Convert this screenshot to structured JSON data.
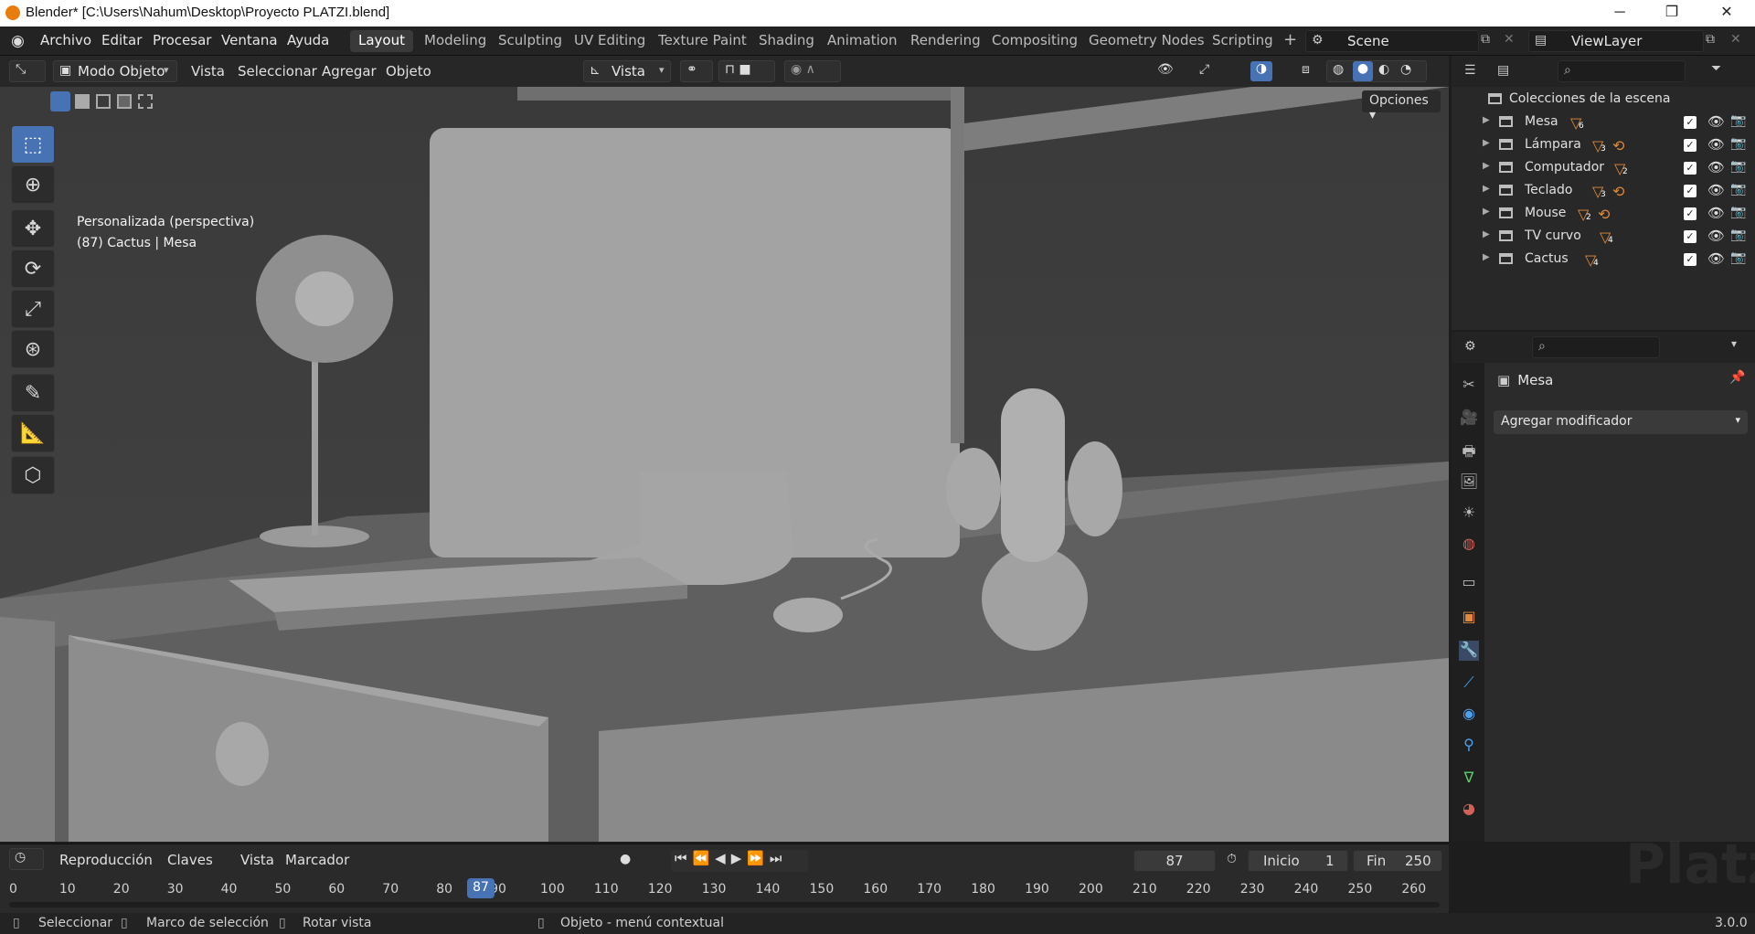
{
  "window": {
    "title": "Blender* [C:\\Users\\Nahum\\Desktop\\Proyecto PLATZI.blend]",
    "minimize": "─",
    "maximize": "❐",
    "close": "✕"
  },
  "menu": [
    "Archivo",
    "Editar",
    "Procesar",
    "Ventana",
    "Ayuda"
  ],
  "workspaces": [
    "Layout",
    "Modeling",
    "Sculpting",
    "UV Editing",
    "Texture Paint",
    "Shading",
    "Animation",
    "Rendering",
    "Compositing",
    "Geometry Nodes",
    "Scripting"
  ],
  "add_workspace": "+",
  "scene": "Scene",
  "viewlayer": "ViewLayer",
  "viewport_header": {
    "mode": "Modo Objeto",
    "menus": [
      "Vista",
      "Seleccionar",
      "Agregar",
      "Objeto"
    ],
    "orientation": "Vista",
    "options": "Opciones"
  },
  "viewport_info": {
    "line1": "Personalizada (perspectiva)",
    "line2": "(87) Cactus | Mesa"
  },
  "outliner": {
    "root": "Colecciones de la escena",
    "items": [
      {
        "name": "Mesa",
        "count": "6",
        "anim": false
      },
      {
        "name": "Lámpara",
        "count": "3",
        "anim": true
      },
      {
        "name": "Computador",
        "count": "2",
        "anim": false
      },
      {
        "name": "Teclado",
        "count": "3",
        "anim": true
      },
      {
        "name": "Mouse",
        "count": "2",
        "anim": true
      },
      {
        "name": "TV curvo",
        "count": "4",
        "anim": false
      },
      {
        "name": "Cactus",
        "count": "4",
        "anim": false
      }
    ]
  },
  "properties": {
    "object": "Mesa",
    "add_modifier": "Agregar modificador"
  },
  "timeline": {
    "menus": [
      "Reproducción",
      "Claves",
      "Vista",
      "Marcador"
    ],
    "current_frame": "87",
    "start_label": "Inicio",
    "start": "1",
    "end_label": "Fin",
    "end": "250",
    "ticks": [
      "0",
      "10",
      "20",
      "30",
      "40",
      "50",
      "60",
      "70",
      "80",
      "90",
      "100",
      "110",
      "120",
      "130",
      "140",
      "150",
      "160",
      "170",
      "180",
      "190",
      "200",
      "210",
      "220",
      "230",
      "240",
      "250",
      "260"
    ]
  },
  "status": {
    "select": "Seleccionar",
    "box_select": "Marco de selección",
    "rotate": "Rotar vista",
    "context_menu": "Objeto - menú contextual",
    "version": "3.0.0"
  },
  "watermark": "Platzi"
}
